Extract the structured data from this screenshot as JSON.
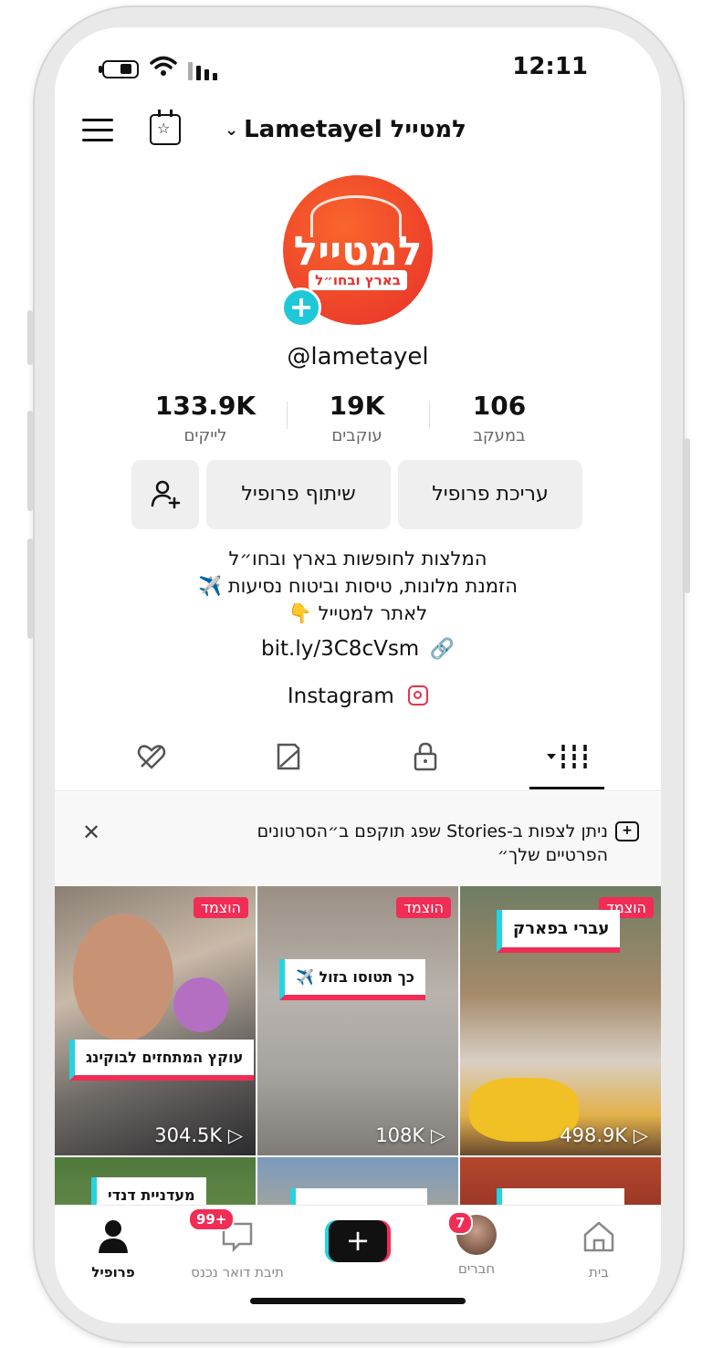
{
  "status_bar": {
    "time": "12:11"
  },
  "header": {
    "account_name": "Lametayel למטייל"
  },
  "avatar": {
    "logo_main": "למטייל",
    "logo_sub": "בארץ ובחו״ל"
  },
  "profile": {
    "handle": "@lametayel",
    "stats": [
      {
        "value": "133.9K",
        "label": "לייקים"
      },
      {
        "value": "19K",
        "label": "עוקבים"
      },
      {
        "value": "106",
        "label": "במעקב"
      }
    ],
    "buttons": {
      "edit": "עריכת פרופיל",
      "share": "שיתוף פרופיל"
    },
    "bio_lines": [
      "המלצות לחופשות בארץ ובחו״ל",
      "הזמנת מלונות, טיסות וביטוח נסיעות ✈️",
      "לאתר למטייל 👇"
    ],
    "link": "bit.ly/3C8cVsm",
    "instagram": "Instagram"
  },
  "banner": {
    "text": "ניתן לצפות ב-Stories שפג תוקפם ב״הסרטונים הפרטיים שלך״"
  },
  "videos": [
    {
      "pinned": "הוצמד",
      "caption": "עוקץ המתחזים לבוקינג",
      "views": "304.5K"
    },
    {
      "pinned": "הוצמד",
      "caption": "כך תטוסו בזול ✈️",
      "views": "108K"
    },
    {
      "pinned": "הוצמד",
      "caption": "עברי בפארק",
      "views": "498.9K"
    },
    {
      "caption": "מעדניית דנדי"
    },
    {
      "caption": ""
    },
    {
      "caption": ""
    }
  ],
  "nav": {
    "home": "בית",
    "friends": "חברים",
    "friends_badge": "7",
    "create": "+",
    "inbox": "תיבת דואר נכנס",
    "inbox_badge": "99+",
    "profile": "פרופיל"
  },
  "colors": {
    "accent_red": "#f12c55",
    "accent_cyan": "#25d3e1",
    "logo_orange": "#f9652c"
  }
}
